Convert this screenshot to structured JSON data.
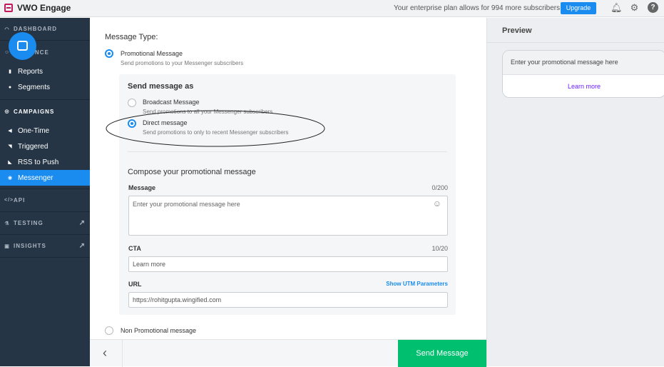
{
  "app": {
    "title": "VWO Engage"
  },
  "topbar": {
    "plan_text": "Your enterprise plan allows for 994 more subscribers",
    "upgrade": "Upgrade",
    "icons": [
      "bell-icon",
      "gear-icon",
      "help-icon"
    ]
  },
  "sidebar": {
    "dashboard": "DASHBOARD",
    "audience": "AUDIENCE",
    "reports": "Reports",
    "segments": "Segments",
    "campaigns": "CAMPAIGNS",
    "one_time": "One-Time",
    "triggered": "Triggered",
    "rss": "RSS to Push",
    "messenger": "Messenger",
    "api": "API",
    "testing": "TESTING",
    "insights": "INSIGHTS"
  },
  "form": {
    "message_type_label": "Message Type:",
    "promo": {
      "label": "Promotional Message",
      "desc": "Send promotions to your Messenger subscribers",
      "selected": true
    },
    "send_as": "Send message as",
    "broadcast": {
      "label": "Broadcast Message",
      "desc": "Send promotions to all your Messenger subscribers",
      "selected": false
    },
    "direct": {
      "label": "Direct message",
      "desc": "Send promotions to only to recent Messenger subscribers",
      "selected": true
    },
    "compose_title": "Compose your promotional message",
    "message_label": "Message",
    "message_count": "0/200",
    "message_placeholder": "Enter your promotional message here",
    "cta_label": "CTA",
    "cta_count": "10/20",
    "cta_value": "Learn more",
    "url_label": "URL",
    "utm_link": "Show UTM Parameters",
    "url_value": "https://rohitgupta.wingified.com",
    "non_promo": {
      "label": "Non Promotional message",
      "selected": false
    }
  },
  "footer": {
    "send": "Send Message"
  },
  "preview": {
    "title": "Preview",
    "message": "Enter your promotional message here",
    "cta": "Learn more"
  },
  "colors": {
    "accent": "#1a8cf0",
    "send": "#00bf6f",
    "sidebar": "#253545"
  }
}
